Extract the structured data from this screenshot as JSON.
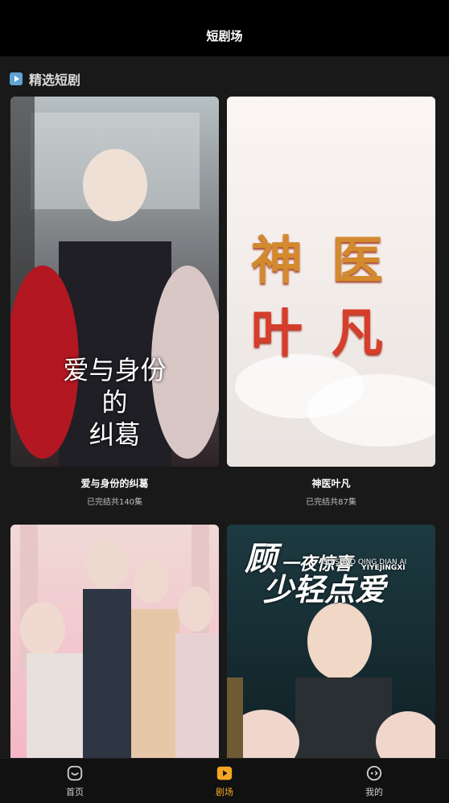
{
  "header": {
    "title": "短剧场"
  },
  "section": {
    "title": "精选短剧"
  },
  "items": [
    {
      "name": "爱与身份的纠葛",
      "meta": "已完结共140集",
      "poster_text": [
        "爱与身份",
        "的",
        "纠葛"
      ]
    },
    {
      "name": "神医叶凡",
      "meta": "已完结共87集",
      "poster_text": [
        "神",
        "医",
        "叶",
        "凡"
      ]
    },
    {
      "name": "",
      "meta": "",
      "poster_text": []
    },
    {
      "name": "",
      "meta": "",
      "poster_text": [
        "顾",
        "一夜惊喜",
        "YIYEJINGXI",
        "GU SHAO QING DIAN AI",
        "少轻点爱"
      ]
    }
  ],
  "tabbar": {
    "tabs": [
      {
        "label": "首页",
        "icon": "home-icon"
      },
      {
        "label": "剧场",
        "icon": "play-icon",
        "active": true
      },
      {
        "label": "我的",
        "icon": "profile-icon"
      }
    ]
  },
  "colors": {
    "accent": "#f6a623",
    "bg": "#191919"
  }
}
